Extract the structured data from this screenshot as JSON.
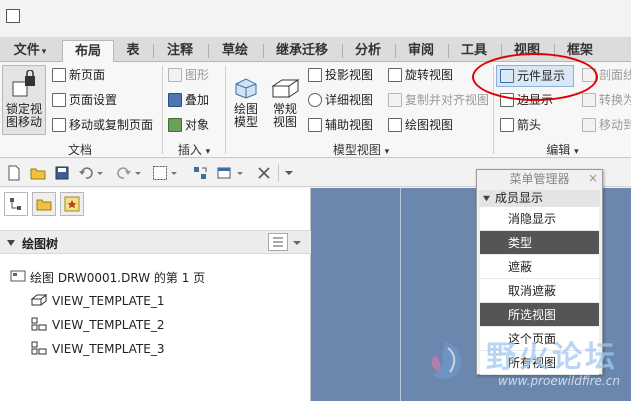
{
  "tabs": [
    {
      "label": "文件",
      "caret": "▾",
      "active": false
    },
    {
      "label": "布局",
      "active": true
    },
    {
      "label": "表",
      "active": false
    },
    {
      "label": "注释",
      "active": false
    },
    {
      "label": "草绘",
      "active": false
    },
    {
      "label": "继承迁移",
      "active": false
    },
    {
      "label": "分析",
      "active": false
    },
    {
      "label": "审阅",
      "active": false
    },
    {
      "label": "工具",
      "active": false
    },
    {
      "label": "视图",
      "active": false
    },
    {
      "label": "框架",
      "active": false
    }
  ],
  "ribbon": {
    "document": {
      "lock_label_1": "锁定视",
      "lock_label_2": "图移动",
      "new_page": "新页面",
      "page_setup": "页面设置",
      "move_copy_page": "移动或复制页面",
      "group_label": "文档"
    },
    "insert": {
      "graphics": "图形",
      "overlay": "叠加",
      "object": "对象",
      "group_label": "插入",
      "caret": "▾"
    },
    "model_views": {
      "drawing_model_1": "绘图",
      "drawing_model_2": "模型",
      "general_1": "常规",
      "general_2": "视图",
      "projection": "投影视图",
      "detailed": "详细视图",
      "auxiliary": "辅助视图",
      "revolved": "旋转视图",
      "copy_align": "复制并对齐视图",
      "drawing_view": "绘图视图",
      "group_label": "模型视图",
      "caret": "▾"
    },
    "edit": {
      "component_display": "元件显示",
      "edge_display": "边显示",
      "arrow": "箭头",
      "cut_line": "剖面线",
      "convert": "转换为",
      "move_to": "移动到",
      "group_label": "编辑",
      "caret": "▾"
    }
  },
  "panel": {
    "tree_title": "绘图树",
    "root": "绘图 DRW0001.DRW 的第 1 页",
    "views": [
      "VIEW_TEMPLATE_1",
      "VIEW_TEMPLATE_2",
      "VIEW_TEMPLATE_3"
    ]
  },
  "menu_manager": {
    "title": "菜单管理器",
    "close": "×",
    "section": "成员显示",
    "items": [
      {
        "label": "消隐显示",
        "selected": false
      },
      {
        "label": "类型",
        "selected": true
      },
      {
        "label": "遮蔽",
        "selected": false
      },
      {
        "label": "取消遮蔽",
        "selected": false
      },
      {
        "label": "所选视图",
        "selected": true
      },
      {
        "label": "这个页面",
        "selected": false
      },
      {
        "label": "所有视图",
        "selected": false
      }
    ]
  },
  "watermark": {
    "text": "野火论坛",
    "url": "www.proewildfire.cn"
  },
  "colors": {
    "canvas": "#6c87ad",
    "selected_item": "#555555",
    "annotation": "#e00000"
  }
}
